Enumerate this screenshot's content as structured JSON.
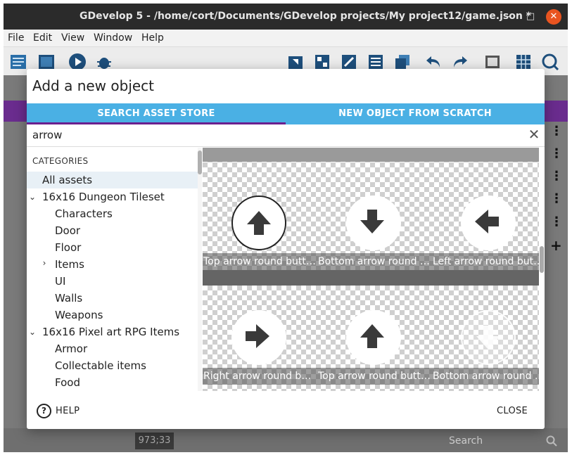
{
  "window": {
    "title": "GDevelop 5 - /home/cort/Documents/GDevelop projects/My project12/game.json *",
    "minimize": "–",
    "maximize": "□",
    "close": "✕"
  },
  "menu": {
    "file": "File",
    "edit": "Edit",
    "view": "View",
    "window": "Window",
    "help": "Help"
  },
  "background": {
    "coords": "973;33",
    "search_placeholder": "Search",
    "add_symbol": "+"
  },
  "dialog": {
    "title": "Add a new object",
    "tabs": [
      {
        "label": "SEARCH ASSET STORE",
        "active": true
      },
      {
        "label": "NEW OBJECT FROM SCRATCH",
        "active": false
      }
    ],
    "search": {
      "value": "arrow",
      "clear_icon": "✕"
    },
    "categories_header": "CATEGORIES",
    "categories": {
      "all": "All assets",
      "dungeon": "16x16 Dungeon Tileset",
      "characters": "Characters",
      "door": "Door",
      "floor": "Floor",
      "items": "Items",
      "ui": "UI",
      "walls": "Walls",
      "weapons": "Weapons",
      "rpg": "16x16 Pixel art RPG Items",
      "armor": "Armor",
      "collectable": "Collectable items",
      "food": "Food"
    },
    "assets": [
      {
        "label": "Top arrow round button",
        "icon": "arrow-up-icon"
      },
      {
        "label": "Bottom arrow round button",
        "icon": "arrow-down-icon"
      },
      {
        "label": "Left arrow round button",
        "icon": "arrow-left-icon"
      },
      {
        "label": "Right arrow round button",
        "icon": "arrow-right-icon"
      },
      {
        "label": "Top arrow round button",
        "icon": "arrow-up-icon"
      },
      {
        "label": "Bottom arrow round button",
        "icon": "arrow-down-icon"
      }
    ],
    "footer": {
      "help_icon": "?",
      "help": "HELP",
      "close": "CLOSE"
    }
  },
  "colors": {
    "tab_bar": "#4ab0e4",
    "tab_indicator": "#6b1f8f",
    "window_close": "#e95420",
    "project_bar": "#6a2c8e"
  }
}
